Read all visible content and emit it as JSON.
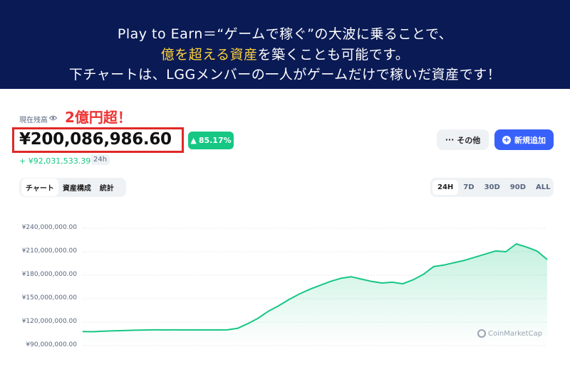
{
  "banner": {
    "line1": "Play to Earn＝“ゲームで稼ぐ”の大波に乗ることで、",
    "line2_highlight": "億を超える資産",
    "line2_rest": "を築くことも可能です。",
    "line3": "下チャートは、LGGメンバーの一人がゲームだけで稼いだ資産です！"
  },
  "balance": {
    "label": "現在残高",
    "annotation": "2億円超！",
    "value": "¥200,086,986.60",
    "percent": "85.17%",
    "change": "+ ¥92,031,533.39",
    "period": "24h"
  },
  "actions": {
    "more_label": "その他",
    "add_label": "新規追加"
  },
  "tabs": [
    "チャート",
    "資産構成",
    "統計"
  ],
  "ranges": [
    "24H",
    "7D",
    "30D",
    "90D",
    "ALL"
  ],
  "watermark": "CoinMarketCap",
  "colors": {
    "banner_bg": "#0a1a55",
    "highlight": "#ffd23a",
    "accent_green": "#16c784",
    "alert_red": "#e02828",
    "button_blue": "#3861fb"
  },
  "chart_data": {
    "type": "area",
    "title": "",
    "xlabel": "",
    "ylabel": "",
    "ylim": [
      90000000,
      240000000
    ],
    "y_ticks": [
      "¥240,000,000.00",
      "¥210,000,000.00",
      "¥180,000,000.00",
      "¥150,000,000.00",
      "¥120,000,000.00",
      "¥90,000,000.00"
    ],
    "y_tick_values": [
      240000000,
      210000000,
      180000000,
      150000000,
      120000000,
      90000000
    ],
    "grid": true,
    "series": [
      {
        "values": [
          108000000,
          107700000,
          108400000,
          108900000,
          109200000,
          109600000,
          109900000,
          110100000,
          110000000,
          110100000,
          110000000,
          110000000,
          110000000,
          110000000,
          110100000,
          112000000,
          118000000,
          125000000,
          134000000,
          141000000,
          149000000,
          156000000,
          162000000,
          167000000,
          172000000,
          176000000,
          178000000,
          175000000,
          172000000,
          170000000,
          171000000,
          169000000,
          174000000,
          181000000,
          191000000,
          193000000,
          196000000,
          199000000,
          203000000,
          207000000,
          211000000,
          210000000,
          220000000,
          216000000,
          211000000,
          200000000
        ]
      }
    ]
  }
}
